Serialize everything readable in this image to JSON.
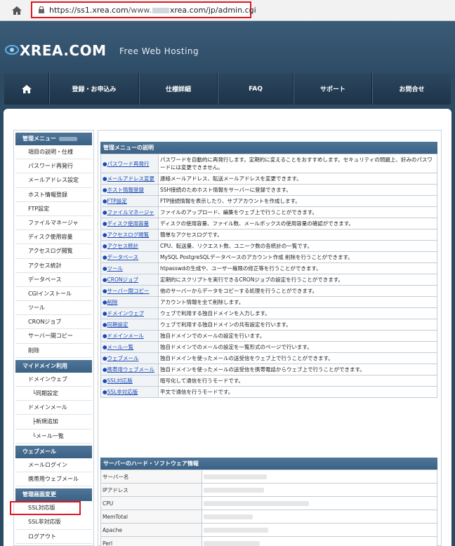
{
  "browser": {
    "url_scheme": "https://ss1.",
    "url_host": "xrea.com",
    "url_rest": "/www.",
    "url_host2": "xrea.com",
    "url_path": "/jp/admin.cgi",
    "home_icon": "home-icon",
    "lock_icon": "lock-icon"
  },
  "site": {
    "logo": "XREA.COM",
    "tagline": "Free Web Hosting"
  },
  "nav": {
    "items": [
      "登録・お申込み",
      "仕様詳細",
      "FAQ",
      "サポート",
      "お問合せ"
    ]
  },
  "sidebar": {
    "admin_menu_title": "管理メニュー",
    "admin_items": [
      "項目の説明・仕様",
      "パスワード再発行",
      "メールアドレス設定",
      "ホスト情報登録",
      "FTP設定",
      "ファイルマネージャ",
      "ディスク使用容量",
      "アクセスログ閲覧",
      "アクセス統計",
      "データベース",
      "CGIインストール",
      "ツール",
      "CRONジョブ",
      "サーバー間コピー",
      "削除"
    ],
    "domain_title": "マイドメイン利用",
    "domain_items": [
      "ドメインウェブ",
      "└同期設定",
      "ドメインメール",
      "├新規追加",
      "└メール一覧"
    ],
    "webmail_title": "ウェブメール",
    "webmail_items": [
      "メールログイン",
      "携帯用ウェブメール"
    ],
    "screen_title": "管理画面変更",
    "screen_items": [
      "SSL対応版",
      "SSL非対応版",
      "ログアウト"
    ]
  },
  "admin_desc": {
    "title": "管理メニューの説明",
    "rows": [
      {
        "key": "パスワード再発行",
        "desc": "パスワードを自動的に再発行します。定期的に変えることをおすすめします。セキュリティの問題上、好みのパスワードには変更できません。"
      },
      {
        "key": "メールアドレス変更",
        "desc": "連絡メールアドレス、転送メールアドレスを変更できます。"
      },
      {
        "key": "ホスト情報登録",
        "desc": "SSH接続のためホスト情報をサーバーに登録できます。"
      },
      {
        "key": "FTP設定",
        "desc": "FTP接続情報を表示したり、サブアカウントを作成します。"
      },
      {
        "key": "ファイルマネージャ",
        "desc": "ファイルのアップロード、編集をウェブ上で行うことができます。"
      },
      {
        "key": "ディスク使用容量",
        "desc": "ディスクの使用容量、ファイル数、メールボックスの使用容量の確認ができます。"
      },
      {
        "key": "アクセスログ閲覧",
        "desc": "簡単なアクセスログです。"
      },
      {
        "key": "アクセス統計",
        "desc": "CPU、転送量、リクエスト数、ユニーク数の各統計の一覧です。"
      },
      {
        "key": "データベース",
        "desc": "MySQL PostgreSQLデータベースのアカウント作成 削除を行うことができます。"
      },
      {
        "key": "ツール",
        "desc": "htpasswdの生成や、ユーザー権限の修正等を行うことができます。"
      },
      {
        "key": "CRONジョブ",
        "desc": "定期的にスクリプトを実行できるCRONジョブの設定を行うことができます。"
      },
      {
        "key": "サーバー間コピー",
        "desc": "他のサーバーからデータをコピーする処理を行うことができます。"
      },
      {
        "key": "削除",
        "desc": "アカウント情報を全て削除します。"
      },
      {
        "key": "ドメインウェブ",
        "desc": "ウェブで利用する独自ドメインを入力します。"
      },
      {
        "key": "同期設定",
        "desc": "ウェブで利用する独自ドメインの共有設定を行います。"
      },
      {
        "key": "ドメインメール",
        "desc": "独自ドメインでのメールの設定を行います。"
      },
      {
        "key": "メール一覧",
        "desc": "独自ドメインでのメールの設定を一覧形式のページで行います。"
      },
      {
        "key": "ウェブメール",
        "desc": "独自ドメインを使ったメールの送受信をウェブ上で行うことができます。"
      },
      {
        "key": "携帯用ウェブメール",
        "desc": "独自ドメインを使ったメールの送受信を携帯電話からウェブ上で行うことができます。"
      },
      {
        "key": "SSL対応版",
        "desc": "暗号化して通信を行うモードです。"
      },
      {
        "key": "SSL非対応版",
        "desc": "平文で通信を行うモードです。"
      }
    ]
  },
  "server_info": {
    "title": "サーバーのハード・ソフトウェア情報",
    "rows": [
      "サーバー名",
      "IPアドレス",
      "CPU",
      "MemTotal",
      "Apache",
      "Perl"
    ]
  }
}
